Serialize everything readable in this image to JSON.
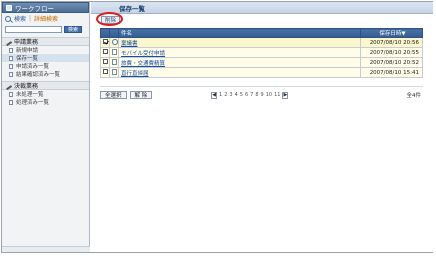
{
  "sidebar": {
    "app_title": "ワークフロー",
    "search_label": "検索",
    "separator": "|",
    "advanced_search_label": "詳細検索",
    "search_input_value": "",
    "search_button_label": "検索",
    "sections": [
      {
        "title": "申請業務",
        "items": [
          {
            "label": "新規申請"
          },
          {
            "label": "保存一覧"
          },
          {
            "label": "申請済み一覧"
          },
          {
            "label": "結果確認済み一覧"
          }
        ]
      },
      {
        "title": "決裁業務",
        "items": [
          {
            "label": "未処理一覧"
          },
          {
            "label": "処理済み一覧"
          }
        ]
      }
    ]
  },
  "main": {
    "title": "保存一覧",
    "delete_button_label": "削除",
    "columns": {
      "subject": "件名",
      "saved_at": "保存日時▼"
    },
    "rows": [
      {
        "subject": "稟議書",
        "saved_at": "2007/08/10 20:56",
        "checked": true
      },
      {
        "subject": "モバイル受付申請",
        "saved_at": "2007/08/10 20:55",
        "checked": false
      },
      {
        "subject": "旅費・交通費精算",
        "saved_at": "2007/08/10 20:52",
        "checked": false
      },
      {
        "subject": "直行直帰届",
        "saved_at": "2007/08/10 15:41",
        "checked": false
      }
    ],
    "select_all_label": "全選択",
    "deselect_label": "解 除",
    "pager": {
      "prev": "◀",
      "pages": [
        "1",
        "2",
        "3",
        "4",
        "5",
        "6",
        "7",
        "8",
        "9",
        "10",
        "11"
      ],
      "next": "▶"
    },
    "total_count": "全4件"
  }
}
